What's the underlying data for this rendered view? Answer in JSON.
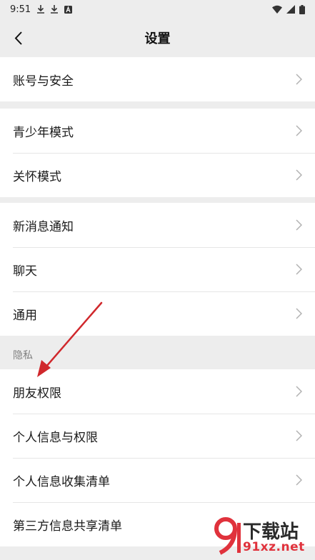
{
  "status_bar": {
    "time": "9:51",
    "icons_left": [
      "download-icon",
      "download-icon",
      "a-box-icon"
    ],
    "icons_right": [
      "wifi-icon",
      "signal-icon",
      "battery-icon"
    ]
  },
  "header": {
    "title": "设置",
    "back_icon": "chevron-left-icon"
  },
  "groups": {
    "account": [
      "账号与安全"
    ],
    "care": [
      "青少年模式",
      "关怀模式"
    ],
    "general": [
      "新消息通知",
      "聊天",
      "通用"
    ],
    "privacy": [
      "朋友权限",
      "个人信息与权限",
      "个人信息收集清单",
      "第三方信息共享清单"
    ]
  },
  "privacy_section_label": "隐私",
  "watermark": {
    "brand": "下载站",
    "domain": "91xz.net"
  },
  "colors": {
    "background": "#ededed",
    "row": "#ffffff",
    "arrow": "#d0282c",
    "chevron": "#b2b2b2"
  }
}
